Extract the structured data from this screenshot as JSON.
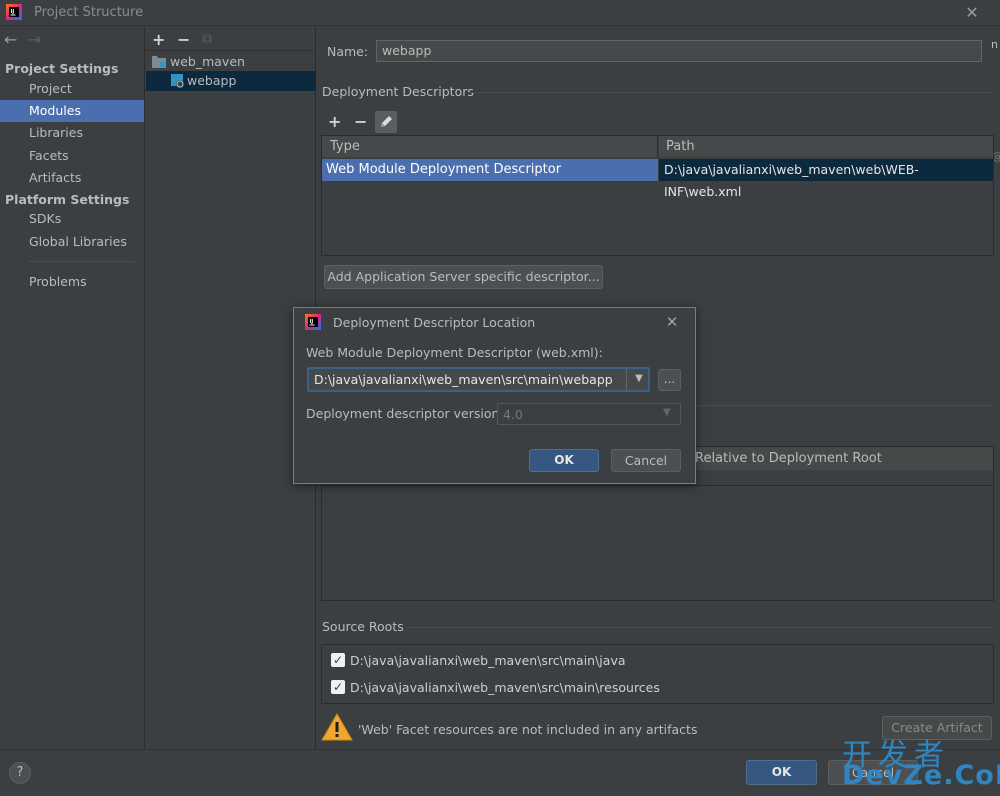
{
  "window": {
    "title": "Project Structure"
  },
  "nav": {
    "back": "←",
    "forward": "→",
    "project_settings": "Project Settings",
    "project_items": [
      "Project",
      "Modules",
      "Libraries",
      "Facets",
      "Artifacts"
    ],
    "platform_settings": "Platform Settings",
    "platform_items": [
      "SDKs",
      "Global Libraries"
    ],
    "problems": "Problems",
    "selected": "Modules"
  },
  "tree": {
    "toolbar": {
      "add": "+",
      "remove": "−",
      "copy": "⧉"
    },
    "root": "web_maven",
    "child": "webapp"
  },
  "main": {
    "name_label": "Name:",
    "name_value": "webapp",
    "deployment_descriptors_title": "Deployment Descriptors",
    "toolbar": {
      "add": "+",
      "remove": "−"
    },
    "table": {
      "headers": [
        "Type",
        "Path"
      ],
      "rows": [
        {
          "type": "Web Module Deployment Descriptor",
          "path": "D:\\java\\javalianxi\\web_maven\\web\\WEB-INF\\web.xml"
        }
      ]
    },
    "add_server_button": "Add Application Server specific descriptor...",
    "web_roots_header_right": "Relative to Deployment Root",
    "source_roots_title": "Source Roots",
    "source_roots": [
      {
        "checked": true,
        "path": "D:\\java\\javalianxi\\web_maven\\src\\main\\java"
      },
      {
        "checked": true,
        "path": "D:\\java\\javalianxi\\web_maven\\src\\main\\resources"
      }
    ],
    "warning": "'Web' Facet resources are not included in any artifacts",
    "create_artifact_button": "Create Artifact"
  },
  "footer": {
    "help": "?",
    "ok": "OK",
    "cancel": "Cancel"
  },
  "dialog": {
    "title": "Deployment Descriptor Location",
    "label": "Web Module Deployment Descriptor (web.xml):",
    "path_value": "D:\\java\\javalianxi\\web_maven\\src\\main\\webapp",
    "browse": "...",
    "version_label": "Deployment descriptor version",
    "version_value": "4.0",
    "ok": "OK",
    "cancel": "Cancel"
  },
  "watermark": {
    "line1": "开发者",
    "line2": "DevZe.CoM"
  },
  "colors": {
    "background": "#3c3f41",
    "selection": "#4b6eaf",
    "accent_button": "#365880",
    "focus_border": "#4a88c7"
  },
  "icons": [
    "intellij-icon",
    "close-icon",
    "back-arrow-icon",
    "forward-arrow-icon",
    "folder-icon",
    "web-module-icon",
    "pencil-icon",
    "dropdown-arrow-icon",
    "warning-icon",
    "help-icon",
    "checkbox-checked-icon"
  ]
}
